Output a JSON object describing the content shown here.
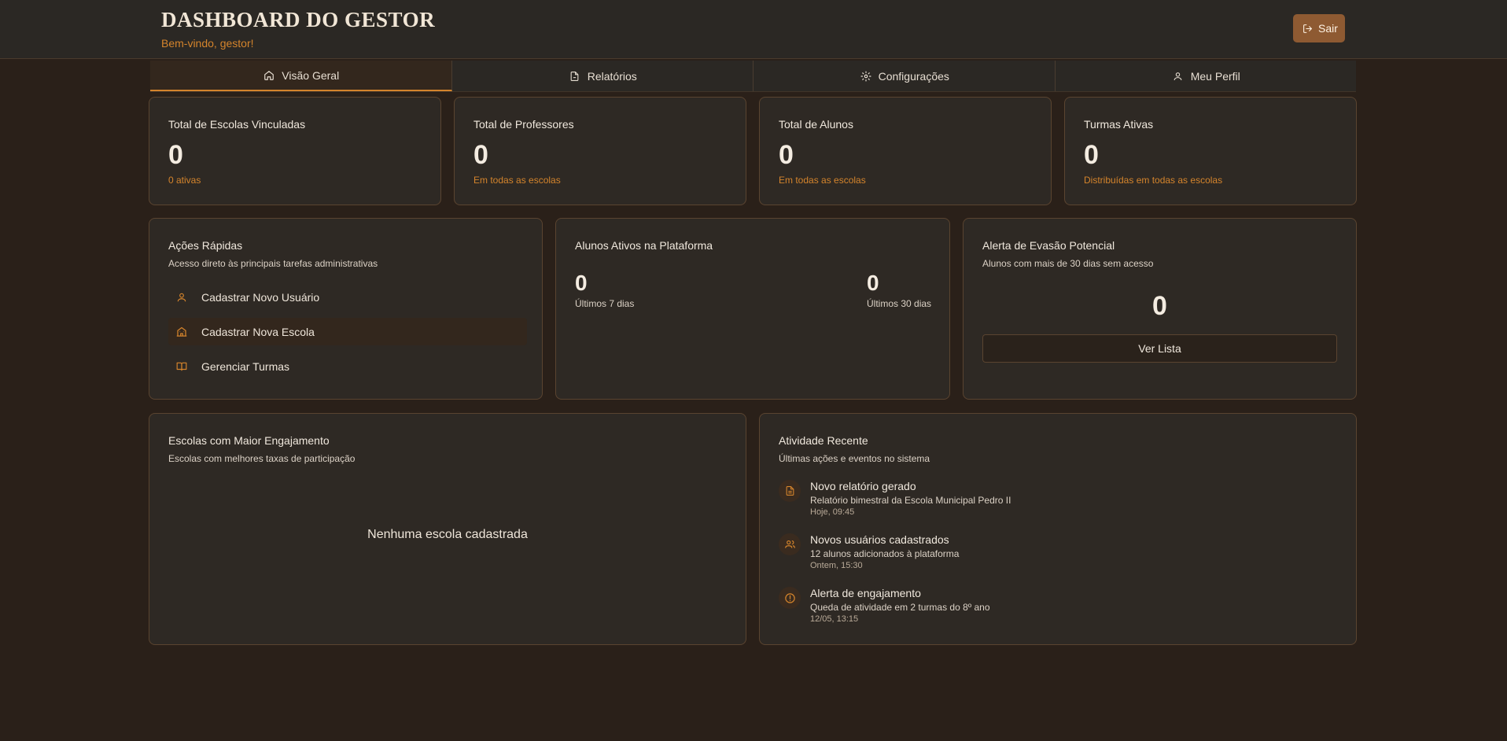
{
  "header": {
    "title": "DASHBOARD DO GESTOR",
    "subtitle": "Bem-vindo, gestor!",
    "logout_label": "Sair"
  },
  "tabs": [
    {
      "label": "Visão Geral",
      "icon": "home-icon",
      "active": true
    },
    {
      "label": "Relatórios",
      "icon": "file-icon",
      "active": false
    },
    {
      "label": "Configurações",
      "icon": "gear-icon",
      "active": false
    },
    {
      "label": "Meu Perfil",
      "icon": "user-icon",
      "active": false
    }
  ],
  "stats": [
    {
      "title": "Total de Escolas Vinculadas",
      "value": "0",
      "note": "0 ativas"
    },
    {
      "title": "Total de Professores",
      "value": "0",
      "note": "Em todas as escolas"
    },
    {
      "title": "Total de Alunos",
      "value": "0",
      "note": "Em todas as escolas"
    },
    {
      "title": "Turmas Ativas",
      "value": "0",
      "note": "Distribuídas em todas as escolas"
    }
  ],
  "quick_actions": {
    "title": "Ações Rápidas",
    "description": "Acesso direto às principais tarefas administrativas",
    "items": [
      {
        "label": "Cadastrar Novo Usuário",
        "icon": "user-icon"
      },
      {
        "label": "Cadastrar Nova Escola",
        "icon": "school-icon"
      },
      {
        "label": "Gerenciar Turmas",
        "icon": "book-icon"
      }
    ]
  },
  "active_students": {
    "title": "Alunos Ativos na Plataforma",
    "week_value": "0",
    "week_label": "Últimos 7 dias",
    "month_value": "0",
    "month_label": "Últimos 30 dias"
  },
  "dropout_alert": {
    "title": "Alerta de Evasão Potencial",
    "description": "Alunos com mais de 30 dias sem acesso",
    "value": "0",
    "button_label": "Ver Lista"
  },
  "engagement": {
    "title": "Escolas com Maior Engajamento",
    "description": "Escolas com melhores taxas de participação",
    "empty_text": "Nenhuma escola cadastrada"
  },
  "recent_activity": {
    "title": "Atividade Recente",
    "description": "Últimas ações e eventos no sistema",
    "items": [
      {
        "icon": "document-icon",
        "title": "Novo relatório gerado",
        "detail": "Relatório bimestral da Escola Municipal Pedro II",
        "when": "Hoje, 09:45"
      },
      {
        "icon": "users-icon",
        "title": "Novos usuários cadastrados",
        "detail": "12 alunos adicionados à plataforma",
        "when": "Ontem, 15:30"
      },
      {
        "icon": "alert-icon",
        "title": "Alerta de engajamento",
        "detail": "Queda de atividade em 2 turmas do 8º ano",
        "when": "12/05, 13:15"
      }
    ]
  },
  "colors": {
    "accent": "#d4842c",
    "background": "#2a2019",
    "card": "#2e2924",
    "border": "#5a4430",
    "button": "#8e5a32"
  }
}
